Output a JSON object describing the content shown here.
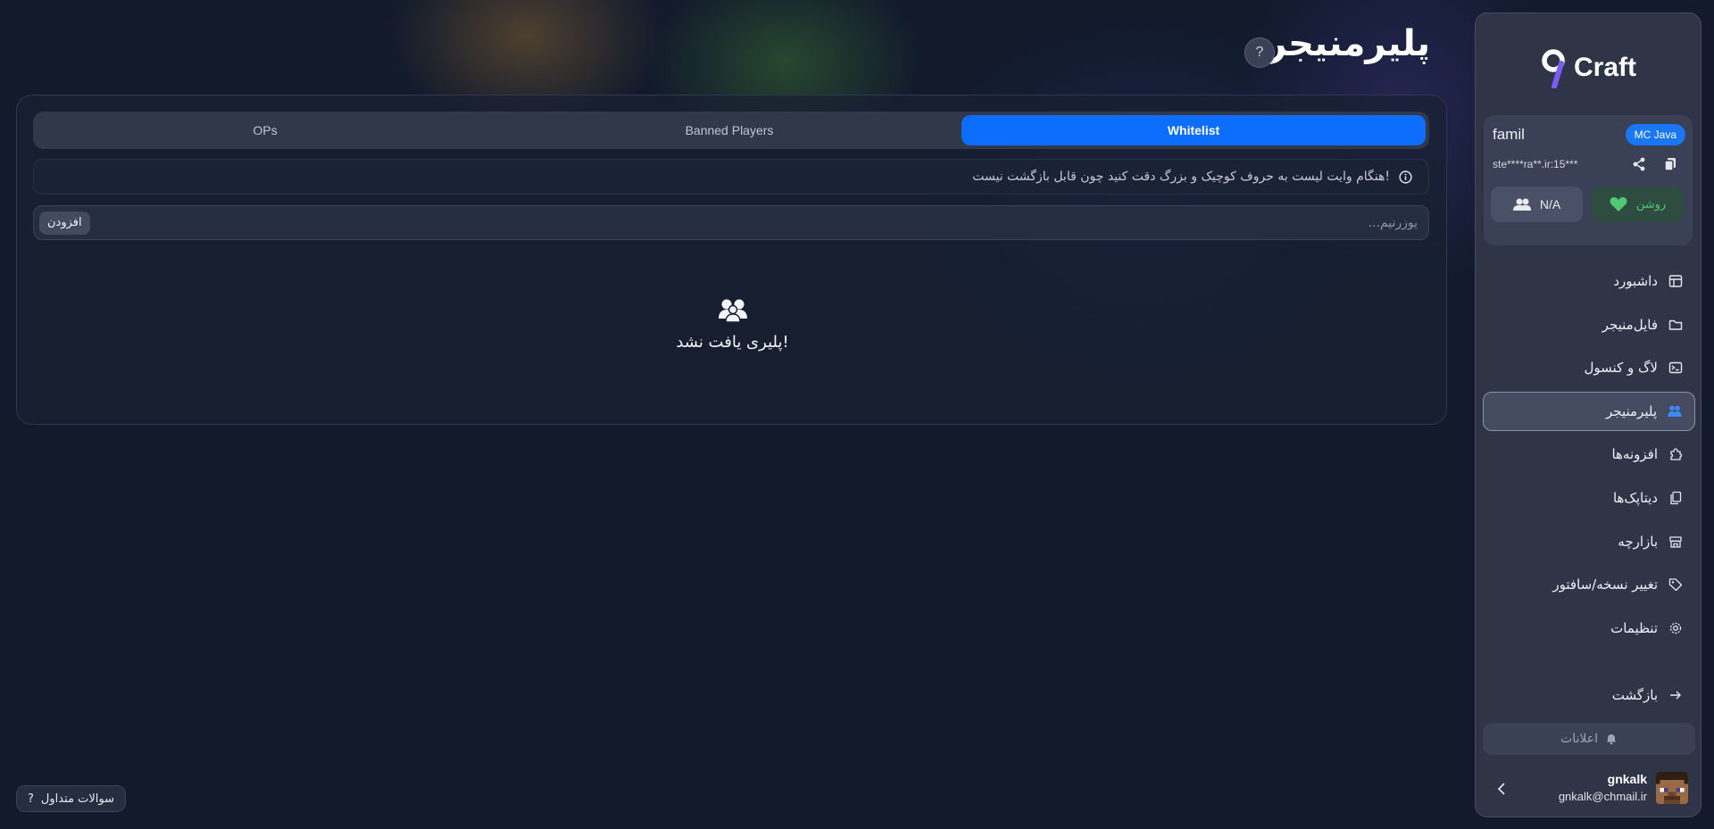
{
  "brand": {
    "name": "Craft"
  },
  "server": {
    "name": "famil",
    "edition": "MC Java",
    "address": "ste****ra**.ir:15***",
    "players": "N/A",
    "status": "روشن"
  },
  "nav": {
    "items": [
      {
        "label": "داشبورد",
        "icon": "layout-icon"
      },
      {
        "label": "فایل‌منیجر",
        "icon": "folder-icon"
      },
      {
        "label": "لاگ و کنسول",
        "icon": "terminal-icon"
      },
      {
        "label": "پلیرمنیجر",
        "icon": "users-icon"
      },
      {
        "label": "افزونه‌ها",
        "icon": "puzzle-icon"
      },
      {
        "label": "دیتاپک‌ها",
        "icon": "files-icon"
      },
      {
        "label": "بازارچه",
        "icon": "store-icon"
      },
      {
        "label": "تغییر نسخه/سافتور",
        "icon": "tag-icon"
      },
      {
        "label": "تنظیمات",
        "icon": "gear-icon"
      }
    ],
    "back": "بازگشت",
    "active_index": 3
  },
  "notifications": {
    "label": "اعلانات"
  },
  "user": {
    "name": "gnkalk",
    "email": "gnkalk@chmail.ir"
  },
  "page": {
    "title": "پلیرمنیجر",
    "help": "?"
  },
  "tabs": {
    "ops": "OPs",
    "banned": "Banned Players",
    "whitelist": "Whitelist",
    "active": "Whitelist"
  },
  "notice": {
    "text": "هنگام وایت لیست به حروف کوچیک و بزرگ دقت کنید چون قابل بازگشت نیست!"
  },
  "add_form": {
    "placeholder": "یوزرنیم...",
    "button": "افزودن"
  },
  "empty_state": {
    "text": "پلیری یافت نشد!"
  },
  "faq": {
    "label": "سوالات متداول",
    "icon": "?"
  },
  "colors": {
    "accent": "#0d6efd",
    "badge": "#1976f5",
    "status_on": "#4fc973",
    "nav_active_icon": "#3d8bfd"
  }
}
